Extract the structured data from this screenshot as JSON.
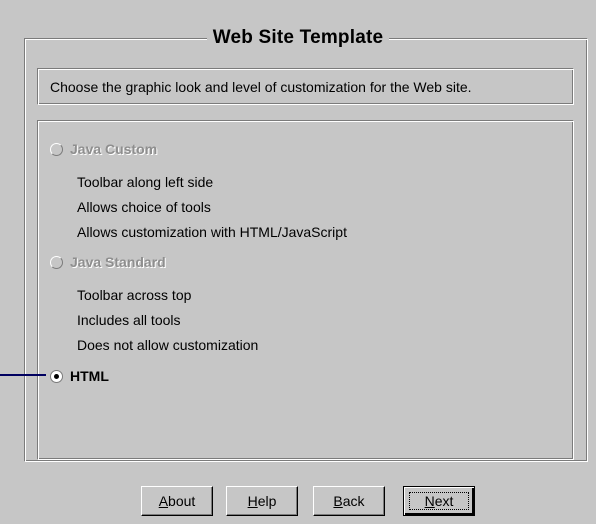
{
  "dialog": {
    "title": "Web Site Template",
    "instruction": "Choose the graphic look and level of customization for the Web site."
  },
  "options": [
    {
      "label": "Java Custom",
      "enabled": false,
      "selected": false,
      "descriptions": [
        "Toolbar along left side",
        "Allows choice of tools",
        "Allows customization with HTML/JavaScript"
      ]
    },
    {
      "label": "Java Standard",
      "enabled": false,
      "selected": false,
      "descriptions": [
        "Toolbar across top",
        "Includes all tools",
        "Does not allow customization"
      ]
    },
    {
      "label": "HTML",
      "enabled": true,
      "selected": true,
      "descriptions": []
    }
  ],
  "buttons": {
    "about": {
      "label_pre": "",
      "label_mnemonic": "A",
      "label_post": "bout"
    },
    "help": {
      "label_pre": "",
      "label_mnemonic": "H",
      "label_post": "elp"
    },
    "back": {
      "label_pre": "",
      "label_mnemonic": "B",
      "label_post": "ack"
    },
    "next": {
      "label_pre": "",
      "label_mnemonic": "N",
      "label_post": "ext"
    }
  },
  "colors": {
    "face": "#c6c6c6",
    "shadow": "#7b7b7b",
    "highlight": "#ffffff",
    "disabled_text": "#8e8e8e",
    "callout": "#000060"
  }
}
